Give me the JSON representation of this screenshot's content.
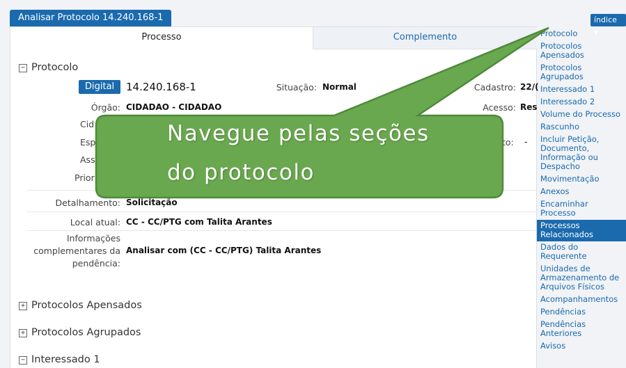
{
  "window": {
    "title": "Analisar Protocolo 14.240.168-1"
  },
  "tabs": [
    {
      "label": "Processo",
      "active": true
    },
    {
      "label": "Complemento",
      "active": false
    }
  ],
  "protocol": {
    "section_label": "Protocolo",
    "badge": "Digital",
    "number": "14.240.168-1",
    "situacao_label": "Situação:",
    "situacao_value": "Normal",
    "cadastro_label": "Cadastro:",
    "cadastro_value": "22/(",
    "orgao_label": "Órgão:",
    "orgao_value": "CIDADAO - CIDADAO",
    "acesso_label": "Acesso:",
    "acesso_value": "Res",
    "cidade_label": "Cid",
    "especie_label": "Esp",
    "assunto_label": "Ass",
    "prioridade_label": "Priori",
    "extra_label": "to:",
    "extra_value": "-",
    "detalhamento_label": "Detalhamento:",
    "detalhamento_value": "Solicitação",
    "local_label": "Local atual:",
    "local_value": "CC - CC/PTG com Talita Arantes",
    "info_label_1": "Informações",
    "info_label_2": "complementares da",
    "info_label_3": "pendência:",
    "info_value": "Analisar com (CC - CC/PTG) Talita Arantes"
  },
  "sections": [
    {
      "label": "Protocolos Apensados",
      "toggle": "+"
    },
    {
      "label": "Protocolos Agrupados",
      "toggle": "+"
    },
    {
      "label": "Interessado 1",
      "toggle": "−"
    }
  ],
  "protocol_toggle": "−",
  "index": {
    "button_label": "índice ▾",
    "items": [
      {
        "label": "Protocolo"
      },
      {
        "label": "Protocolos Apensados"
      },
      {
        "label": "Protocolos Agrupados"
      },
      {
        "label": "Interessado 1"
      },
      {
        "label": "Interessado 2"
      },
      {
        "label": "Volume do Processo"
      },
      {
        "label": "Rascunho"
      },
      {
        "label": "Incluir Petição, Documento, Informação ou Despacho"
      },
      {
        "label": "Movimentação"
      },
      {
        "label": "Anexos"
      },
      {
        "label": "Encaminhar Processo"
      },
      {
        "label": "Processos Relacionados",
        "active": true
      },
      {
        "label": "Dados do Requerente"
      },
      {
        "label": "Unidades de Armazenamento de Arquivos Físicos"
      },
      {
        "label": "Acompanhamentos"
      },
      {
        "label": "Pendências"
      },
      {
        "label": "Pendências Anteriores"
      },
      {
        "label": "Avisos"
      }
    ]
  },
  "callout": {
    "line1": "Navegue pelas seções",
    "line2": "do protocolo",
    "fill": "#6aa84f",
    "stroke": "#4e8a3a"
  }
}
